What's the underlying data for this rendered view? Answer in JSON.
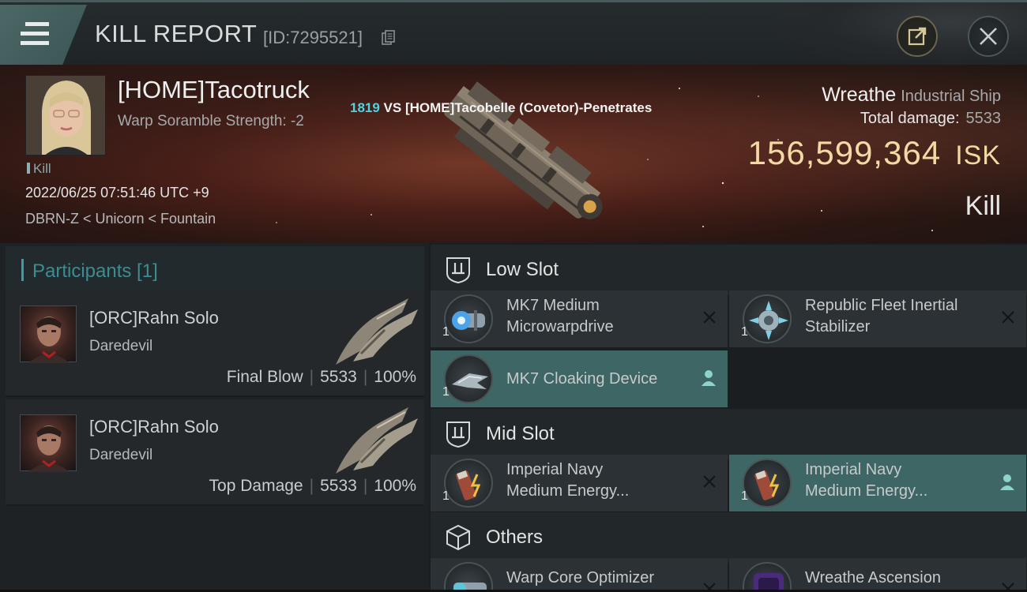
{
  "header": {
    "title": "KILL REPORT",
    "report_id": "[ID:7295521]"
  },
  "victim": {
    "name": "[HOME]Tacotruck",
    "warp_scramble": "Warp Soramble Strength: -2",
    "type_tag": "Kill",
    "datetime": "2022/06/25 07:51:46 UTC +9",
    "location": "DBRN-Z < Unicorn < Fountain"
  },
  "versus": {
    "number": "1819",
    "text": " VS [HOME]Tacobelle (Covetor)-Penetrates"
  },
  "ship": {
    "name": "Wreathe",
    "class": "Industrial Ship",
    "total_damage_label": "Total damage:",
    "total_damage_value": "5533",
    "isk_value": "156,599,364",
    "isk_unit": "ISK",
    "result": "Kill"
  },
  "participants": {
    "title": "Participants [1]",
    "rows": [
      {
        "name": "[ORC]Rahn Solo",
        "ship": "Daredevil",
        "role": "Final Blow",
        "damage": "5533",
        "percent": "100%"
      },
      {
        "name": "[ORC]Rahn Solo",
        "ship": "Daredevil",
        "role": "Top Damage",
        "damage": "5533",
        "percent": "100%"
      }
    ]
  },
  "fittings": {
    "low_slot": {
      "title": "Low Slot",
      "modules": [
        {
          "qty": "1",
          "line1": "MK7 Medium",
          "line2": "Microwarpdrive",
          "status": "destroyed"
        },
        {
          "qty": "1",
          "line1": "Republic Fleet Inertial",
          "line2": "Stabilizer",
          "status": "destroyed"
        },
        {
          "qty": "1",
          "line1": "MK7 Cloaking Device",
          "line2": "",
          "status": "dropped"
        }
      ]
    },
    "mid_slot": {
      "title": "Mid Slot",
      "modules": [
        {
          "qty": "1",
          "line1": "Imperial Navy",
          "line2": "Medium Energy...",
          "status": "destroyed"
        },
        {
          "qty": "1",
          "line1": "Imperial Navy",
          "line2": "Medium Energy...",
          "status": "dropped"
        }
      ]
    },
    "others": {
      "title": "Others",
      "modules": [
        {
          "qty": "",
          "line1": "Warp Core Optimizer",
          "line2": "",
          "status": "destroyed"
        },
        {
          "qty": "",
          "line1": "Wreathe Ascension",
          "line2": "",
          "status": "destroyed"
        }
      ]
    }
  },
  "colors": {
    "accent_teal": "#3a8d92",
    "active_module": "#3d6664",
    "isk_gold": "#f3d9a4",
    "vs_number": "#4fd3e0"
  },
  "icons": {
    "menu": "hamburger-icon",
    "copy": "copy-icon",
    "share": "share-icon",
    "close": "close-icon",
    "destroyed": "x-icon",
    "dropped": "person-icon",
    "slot": "slot-icon",
    "others": "cube-icon"
  }
}
